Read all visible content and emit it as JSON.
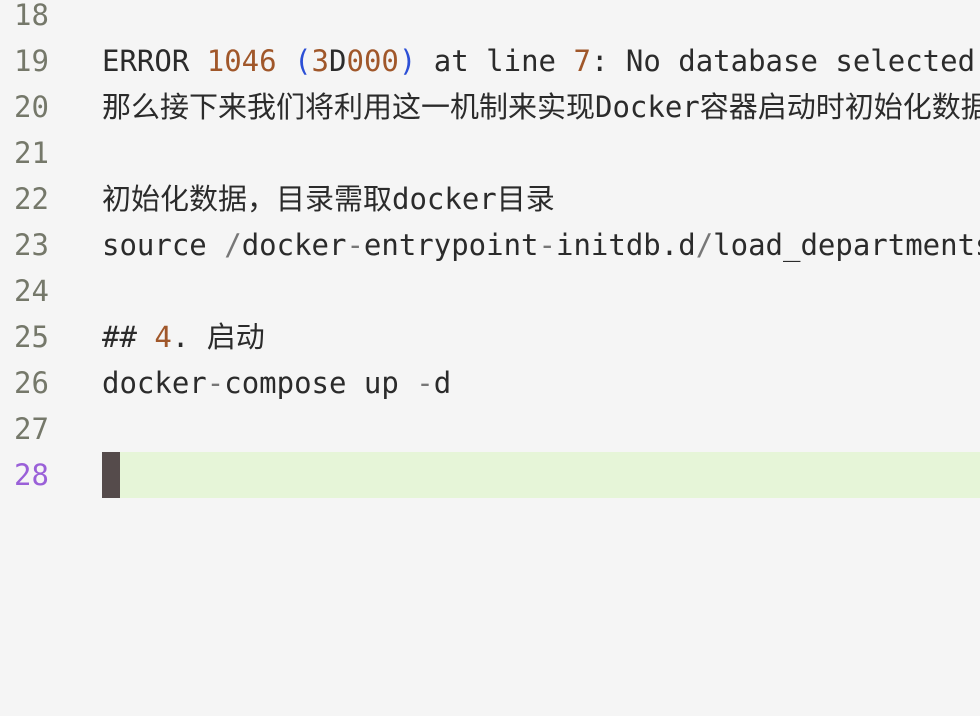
{
  "editor": {
    "lines": [
      {
        "num": "18",
        "segments": []
      },
      {
        "num": "19",
        "segments": [
          {
            "text": "ERROR ",
            "style": "plain"
          },
          {
            "text": "1046",
            "style": "num"
          },
          {
            "text": " ",
            "style": "plain"
          },
          {
            "text": "(",
            "style": "paren"
          },
          {
            "text": "3",
            "style": "num"
          },
          {
            "text": "D",
            "style": "plain"
          },
          {
            "text": "000",
            "style": "num"
          },
          {
            "text": ")",
            "style": "paren"
          },
          {
            "text": " at line ",
            "style": "plain"
          },
          {
            "text": "7",
            "style": "num"
          },
          {
            "text": ": No database selected",
            "style": "plain"
          }
        ]
      },
      {
        "num": "20",
        "segments": [
          {
            "text": "那么接下来我们将利用这一机制来实现Docker容器启动时初始化数据",
            "style": "plain"
          }
        ]
      },
      {
        "num": "21",
        "segments": []
      },
      {
        "num": "22",
        "segments": [
          {
            "text": "初始化数据，目录需取docker目录",
            "style": "plain"
          }
        ]
      },
      {
        "num": "23",
        "segments": [
          {
            "text": "source ",
            "style": "plain"
          },
          {
            "text": "/",
            "style": "path"
          },
          {
            "text": "docker",
            "style": "plain"
          },
          {
            "text": "-",
            "style": "path"
          },
          {
            "text": "entrypoint",
            "style": "plain"
          },
          {
            "text": "-",
            "style": "path"
          },
          {
            "text": "initdb.d",
            "style": "plain"
          },
          {
            "text": "/",
            "style": "path"
          },
          {
            "text": "load_departments.dump",
            "style": "plain"
          }
        ]
      },
      {
        "num": "24",
        "segments": []
      },
      {
        "num": "25",
        "segments": [
          {
            "text": "## ",
            "style": "plain"
          },
          {
            "text": "4",
            "style": "num"
          },
          {
            "text": ". 启动",
            "style": "plain"
          }
        ]
      },
      {
        "num": "26",
        "segments": [
          {
            "text": "docker",
            "style": "plain"
          },
          {
            "text": "-",
            "style": "path"
          },
          {
            "text": "compose up ",
            "style": "plain"
          },
          {
            "text": "-",
            "style": "path"
          },
          {
            "text": "d",
            "style": "plain"
          }
        ]
      },
      {
        "num": "27",
        "segments": []
      },
      {
        "num": "28",
        "segments": [],
        "active": true
      }
    ],
    "colors": {
      "background": "#f5f5f5",
      "active_line": "#e6f5d8",
      "line_number": "#75786a",
      "active_line_number": "#9a60d8",
      "number_literal": "#a0572a",
      "paren": "#2c4fd6",
      "cursor": "#554b4b"
    }
  }
}
